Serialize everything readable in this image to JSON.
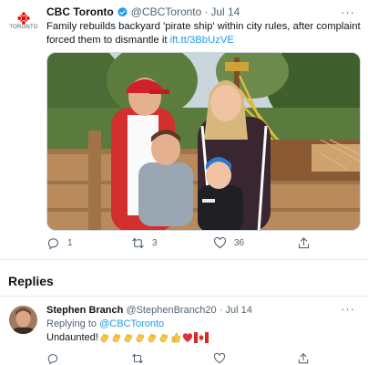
{
  "tweet": {
    "account_name": "CBC Toronto",
    "handle": "@CBCToronto",
    "separator": "·",
    "date": "Jul 14",
    "avatar_text": "TORONTO",
    "text": "Family rebuilds backyard 'pirate ship' within city rules, after complaint forced them to dismantle it ",
    "link": "ift.tt/3BbUzVE",
    "more_label": "···",
    "actions": {
      "reply_count": "1",
      "retweet_count": "3",
      "like_count": "36"
    }
  },
  "replies_section": {
    "title": "Replies"
  },
  "reply": {
    "name": "Stephen Branch",
    "handle": "@StephenBranch20",
    "separator": "·",
    "date": "Jul 14",
    "replying_prefix": "Replying to ",
    "replying_to": "@CBCToronto",
    "text": "Undaunted!",
    "emoji_sequence": [
      "clapping-hands",
      "clapping-hands",
      "clapping-hands",
      "clapping-hands",
      "clapping-hands",
      "clapping-hands",
      "thumbs-up",
      "red-heart",
      "canada-flag"
    ],
    "more_label": "···"
  },
  "colors": {
    "link": "#1d9bf0",
    "secondary_text": "#536471",
    "cbc_red": "#e60505",
    "divider": "#e6e9eb"
  }
}
